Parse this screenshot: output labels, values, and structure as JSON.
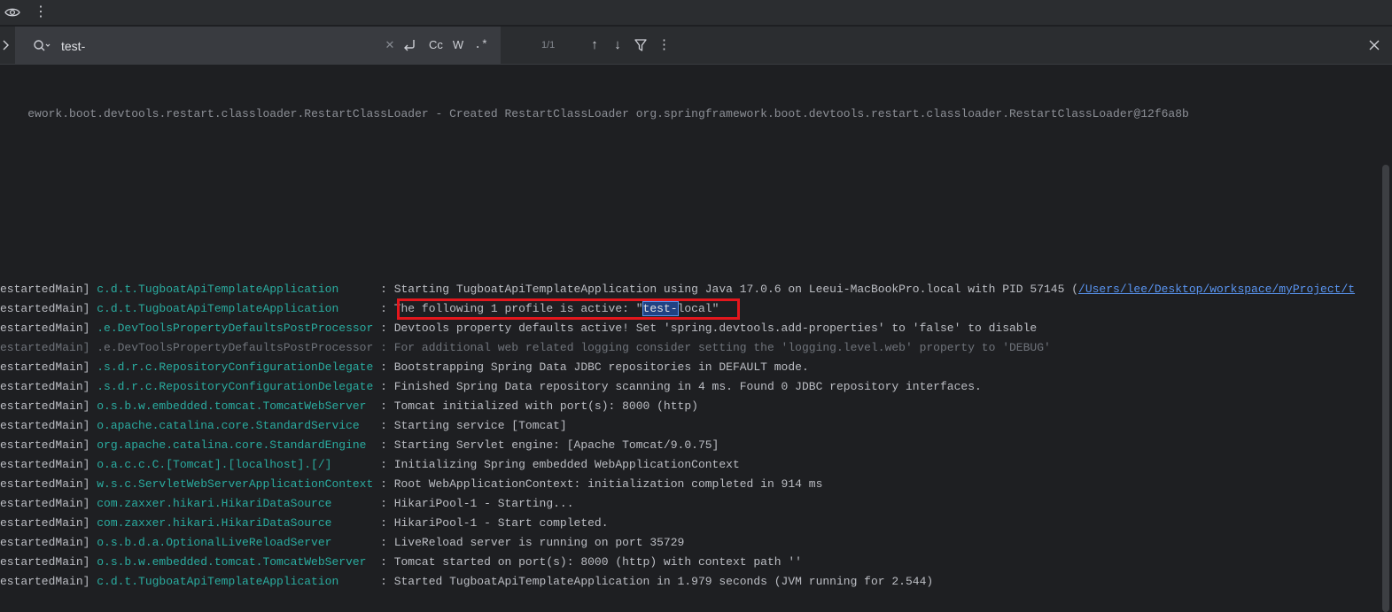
{
  "toolbar": {
    "view_icon": "eye-icon",
    "more_icon": "kebab-icon",
    "more_glyph": "⋮"
  },
  "search": {
    "value": "test-",
    "placeholder": "",
    "clear_glyph": "✕",
    "case_label": "Cc",
    "word_label": "W",
    "regex_label": ".*",
    "match_count": "1/1",
    "prev_glyph": "↑",
    "next_glyph": "↓",
    "more_glyph": "⋮"
  },
  "colors": {
    "background": "#1e1f22",
    "toolbar": "#2b2d30",
    "logger": "#2aaca0",
    "highlight": "#214283",
    "annotation_box": "#e3171d",
    "link": "#5994f0"
  },
  "console": {
    "first_line": "ework.boot.devtools.restart.classloader.RestartClassLoader - Created RestartClassLoader org.springframework.boot.devtools.restart.classloader.RestartClassLoader@12f6a8b",
    "lines": [
      {
        "thread": "estartedMain] ",
        "logger": "c.d.t.TugboatApiTemplateApplication      ",
        "sep": ": ",
        "msg": "Starting TugboatApiTemplateApplication using Java 17.0.6 on Leeui-MacBookPro.local with PID 57145 (",
        "link": "/Users/lee/Desktop/workspace/myProject/t"
      },
      {
        "thread": "estartedMain] ",
        "logger": "c.d.t.TugboatApiTemplateApplication      ",
        "sep": ": ",
        "msg_before": "The following 1 profile is active: \"",
        "match": "test-",
        "msg_after": "local\""
      },
      {
        "thread": "estartedMain] ",
        "logger": ".e.DevToolsPropertyDefaultsPostProcessor ",
        "sep": ": ",
        "msg": "Devtools property defaults active! Set 'spring.devtools.add-properties' to 'false' to disable"
      },
      {
        "thread": "estartedMain] ",
        "logger": ".e.DevToolsPropertyDefaultsPostProcessor ",
        "sep": ": ",
        "msg": "For additional web related logging consider setting the 'logging.level.web' property to 'DEBUG'",
        "dim": true
      },
      {
        "thread": "estartedMain] ",
        "logger": ".s.d.r.c.RepositoryConfigurationDelegate ",
        "sep": ": ",
        "msg": "Bootstrapping Spring Data JDBC repositories in DEFAULT mode."
      },
      {
        "thread": "estartedMain] ",
        "logger": ".s.d.r.c.RepositoryConfigurationDelegate ",
        "sep": ": ",
        "msg": "Finished Spring Data repository scanning in 4 ms. Found 0 JDBC repository interfaces."
      },
      {
        "thread": "estartedMain] ",
        "logger": "o.s.b.w.embedded.tomcat.TomcatWebServer  ",
        "sep": ": ",
        "msg": "Tomcat initialized with port(s): 8000 (http)"
      },
      {
        "thread": "estartedMain] ",
        "logger": "o.apache.catalina.core.StandardService   ",
        "sep": ": ",
        "msg": "Starting service [Tomcat]"
      },
      {
        "thread": "estartedMain] ",
        "logger": "org.apache.catalina.core.StandardEngine  ",
        "sep": ": ",
        "msg": "Starting Servlet engine: [Apache Tomcat/9.0.75]"
      },
      {
        "thread": "estartedMain] ",
        "logger": "o.a.c.c.C.[Tomcat].[localhost].[/]       ",
        "sep": ": ",
        "msg": "Initializing Spring embedded WebApplicationContext"
      },
      {
        "thread": "estartedMain] ",
        "logger": "w.s.c.ServletWebServerApplicationContext ",
        "sep": ": ",
        "msg": "Root WebApplicationContext: initialization completed in 914 ms"
      },
      {
        "thread": "estartedMain] ",
        "logger": "com.zaxxer.hikari.HikariDataSource       ",
        "sep": ": ",
        "msg": "HikariPool-1 - Starting..."
      },
      {
        "thread": "estartedMain] ",
        "logger": "com.zaxxer.hikari.HikariDataSource       ",
        "sep": ": ",
        "msg": "HikariPool-1 - Start completed."
      },
      {
        "thread": "estartedMain] ",
        "logger": "o.s.b.d.a.OptionalLiveReloadServer       ",
        "sep": ": ",
        "msg": "LiveReload server is running on port 35729"
      },
      {
        "thread": "estartedMain] ",
        "logger": "o.s.b.w.embedded.tomcat.TomcatWebServer  ",
        "sep": ": ",
        "msg": "Tomcat started on port(s): 8000 (http) with context path ''"
      },
      {
        "thread": "estartedMain] ",
        "logger": "c.d.t.TugboatApiTemplateApplication      ",
        "sep": ": ",
        "msg": "Started TugboatApiTemplateApplication in 1.979 seconds (JVM running for 2.544)"
      }
    ]
  }
}
